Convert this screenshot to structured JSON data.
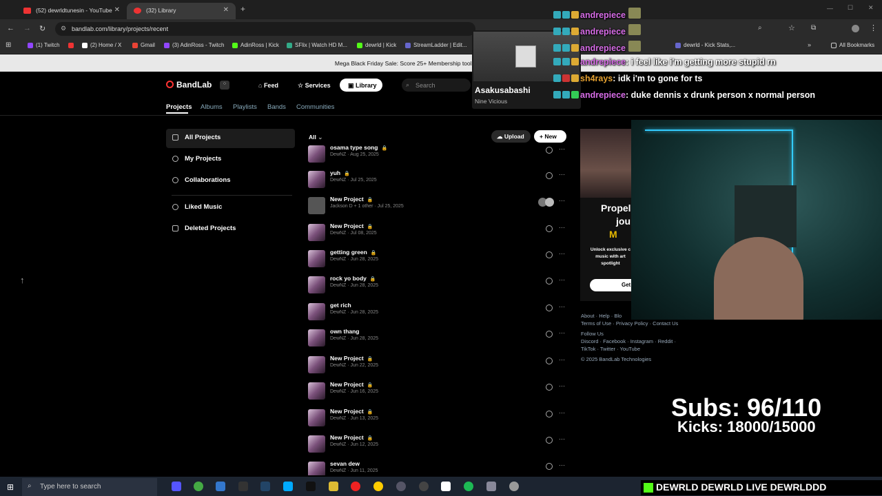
{
  "browser": {
    "tabs": [
      {
        "label": "(52) dewrldtunesin - YouTube"
      },
      {
        "label": "(32) Library"
      }
    ],
    "url": "bandlab.com/library/projects/recent",
    "bookmarks": [
      "(1) Twitch",
      "(2) Home / X",
      "Gmail",
      "(3) AdinRoss - Twitch",
      "AdinRoss | Kick",
      "SFlix | Watch HD M...",
      "dewrld | Kick",
      "StreamLadder | Edit...",
      "dewrld - Kick Stats,...",
      "All Bookmarks"
    ]
  },
  "banner": {
    "text": "Mega Black Friday Sale: Score 25+ Membership tools, 35 sale-only rewards & mo"
  },
  "bandlab": {
    "logo": "BandLab",
    "nav": {
      "feed": "Feed",
      "services": "Services",
      "library": "Library",
      "search_placeholder": "Search"
    },
    "tabs": [
      "Projects",
      "Albums",
      "Playlists",
      "Bands",
      "Communities"
    ],
    "sidebar": [
      "All Projects",
      "My Projects",
      "Collaborations",
      "Liked Music",
      "Deleted Projects"
    ],
    "filter": "All",
    "upload": "Upload",
    "new": "New",
    "projects": [
      {
        "title": "osama type song",
        "meta": "DewNZ  ·  Aug 25, 2025"
      },
      {
        "title": "yuh",
        "meta": "DewNZ  ·  Jul 25, 2025"
      },
      {
        "title": "New Project",
        "meta": "Jackson D + 1 other  ·  Jul 25, 2025"
      },
      {
        "title": "New Project",
        "meta": "DewNZ  ·  Jul 08, 2025"
      },
      {
        "title": "getting green",
        "meta": "DewNZ  ·  Jun 28, 2025"
      },
      {
        "title": "rock yo body",
        "meta": "DewNZ  ·  Jun 28, 2025"
      },
      {
        "title": "get rich",
        "meta": "DewNZ  ·  Jun 28, 2025"
      },
      {
        "title": "own thang",
        "meta": "DewNZ  ·  Jun 28, 2025"
      },
      {
        "title": "New Project",
        "meta": "DewNZ  ·  Jun 22, 2025"
      },
      {
        "title": "New Project",
        "meta": "DewNZ  ·  Jun 16, 2025"
      },
      {
        "title": "New Project",
        "meta": "DewNZ  ·  Jun 13, 2025"
      },
      {
        "title": "New Project",
        "meta": "DewNZ  ·  Jun 12, 2025"
      },
      {
        "title": "sevan dew",
        "meta": "DewNZ  ·  Jun 11, 2025"
      }
    ],
    "promo": {
      "title": "Propel",
      "line2": "jou",
      "line3": "M",
      "body": "Unlock exclusive c music with art spotlight",
      "btn": "Get"
    },
    "footer": {
      "links1": "About · Help · Blo",
      "links2": "Terms of Use · Privacy Policy · Contact Us",
      "follow": "Follow Us",
      "social1": "Discord · Facebook · Instagram · Reddit ·",
      "social2": "TikTok · Twitter · YouTube",
      "copyright": "© 2025 BandLab Technologies"
    }
  },
  "now_playing": {
    "title": "Asakusabashi",
    "artist": "Nine Vicious"
  },
  "chat": [
    {
      "name": "andrepiece",
      "msg": ""
    },
    {
      "name": "andrepiece",
      "msg": ""
    },
    {
      "name": "andrepiece",
      "msg": ""
    },
    {
      "name": "andrepiece",
      "msg": ": i feel like i'm getting more stupid rn"
    },
    {
      "name": "sh4rays",
      "msg": ": idk i'm to gone for ts"
    },
    {
      "name": "andrepiece",
      "msg": ": duke dennis x drunk person x normal person"
    }
  ],
  "overlay": {
    "subs": "Subs: 96/110",
    "kicks": "Kicks: 18000/15000",
    "banner": "DEWRLD  DEWRLD LIVE  DEWRLDDD"
  },
  "taskbar": {
    "search_placeholder": "Type here to search"
  }
}
